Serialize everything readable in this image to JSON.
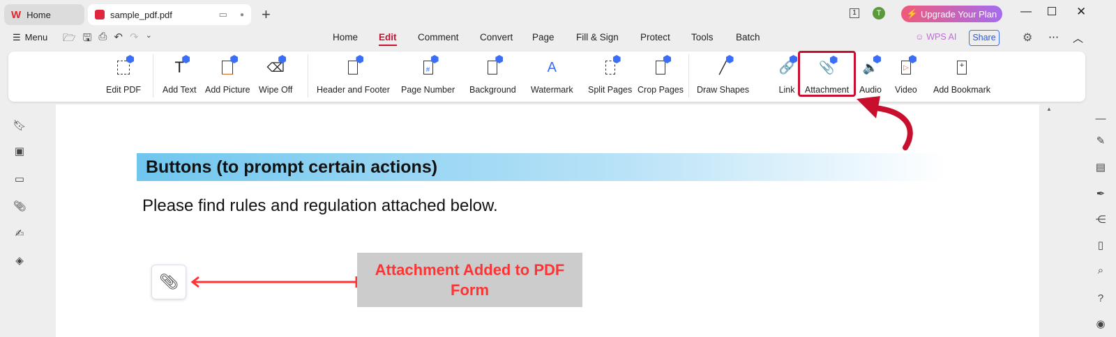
{
  "tabs": [
    {
      "label": "Home"
    },
    {
      "label": "sample_pdf.pdf"
    }
  ],
  "titlebar": {
    "page_indicator": "1",
    "avatar_letter": "T",
    "upgrade_label": "Upgrade Your Plan"
  },
  "menu": {
    "label": "Menu"
  },
  "nav": [
    "Home",
    "Edit",
    "Comment",
    "Convert",
    "Page",
    "Fill & Sign",
    "Protect",
    "Tools",
    "Batch"
  ],
  "right_actions": {
    "wps_ai": "WPS AI",
    "share": "Share"
  },
  "ribbon": [
    "Edit PDF",
    "Add Text",
    "Add Picture",
    "Wipe Off",
    "Header and Footer",
    "Page Number",
    "Background",
    "Watermark",
    "Split Pages",
    "Crop Pages",
    "Draw Shapes",
    "Link",
    "Attachment",
    "Audio",
    "Video",
    "Add Bookmark"
  ],
  "document": {
    "heading": "Buttons (to prompt certain actions)",
    "body": "Please find rules and regulation attached below.",
    "callout": "Attachment Added to PDF Form"
  },
  "colors": {
    "accent": "#c8102e",
    "annotation": "#ff3333",
    "callout_bg": "#cccccc"
  }
}
